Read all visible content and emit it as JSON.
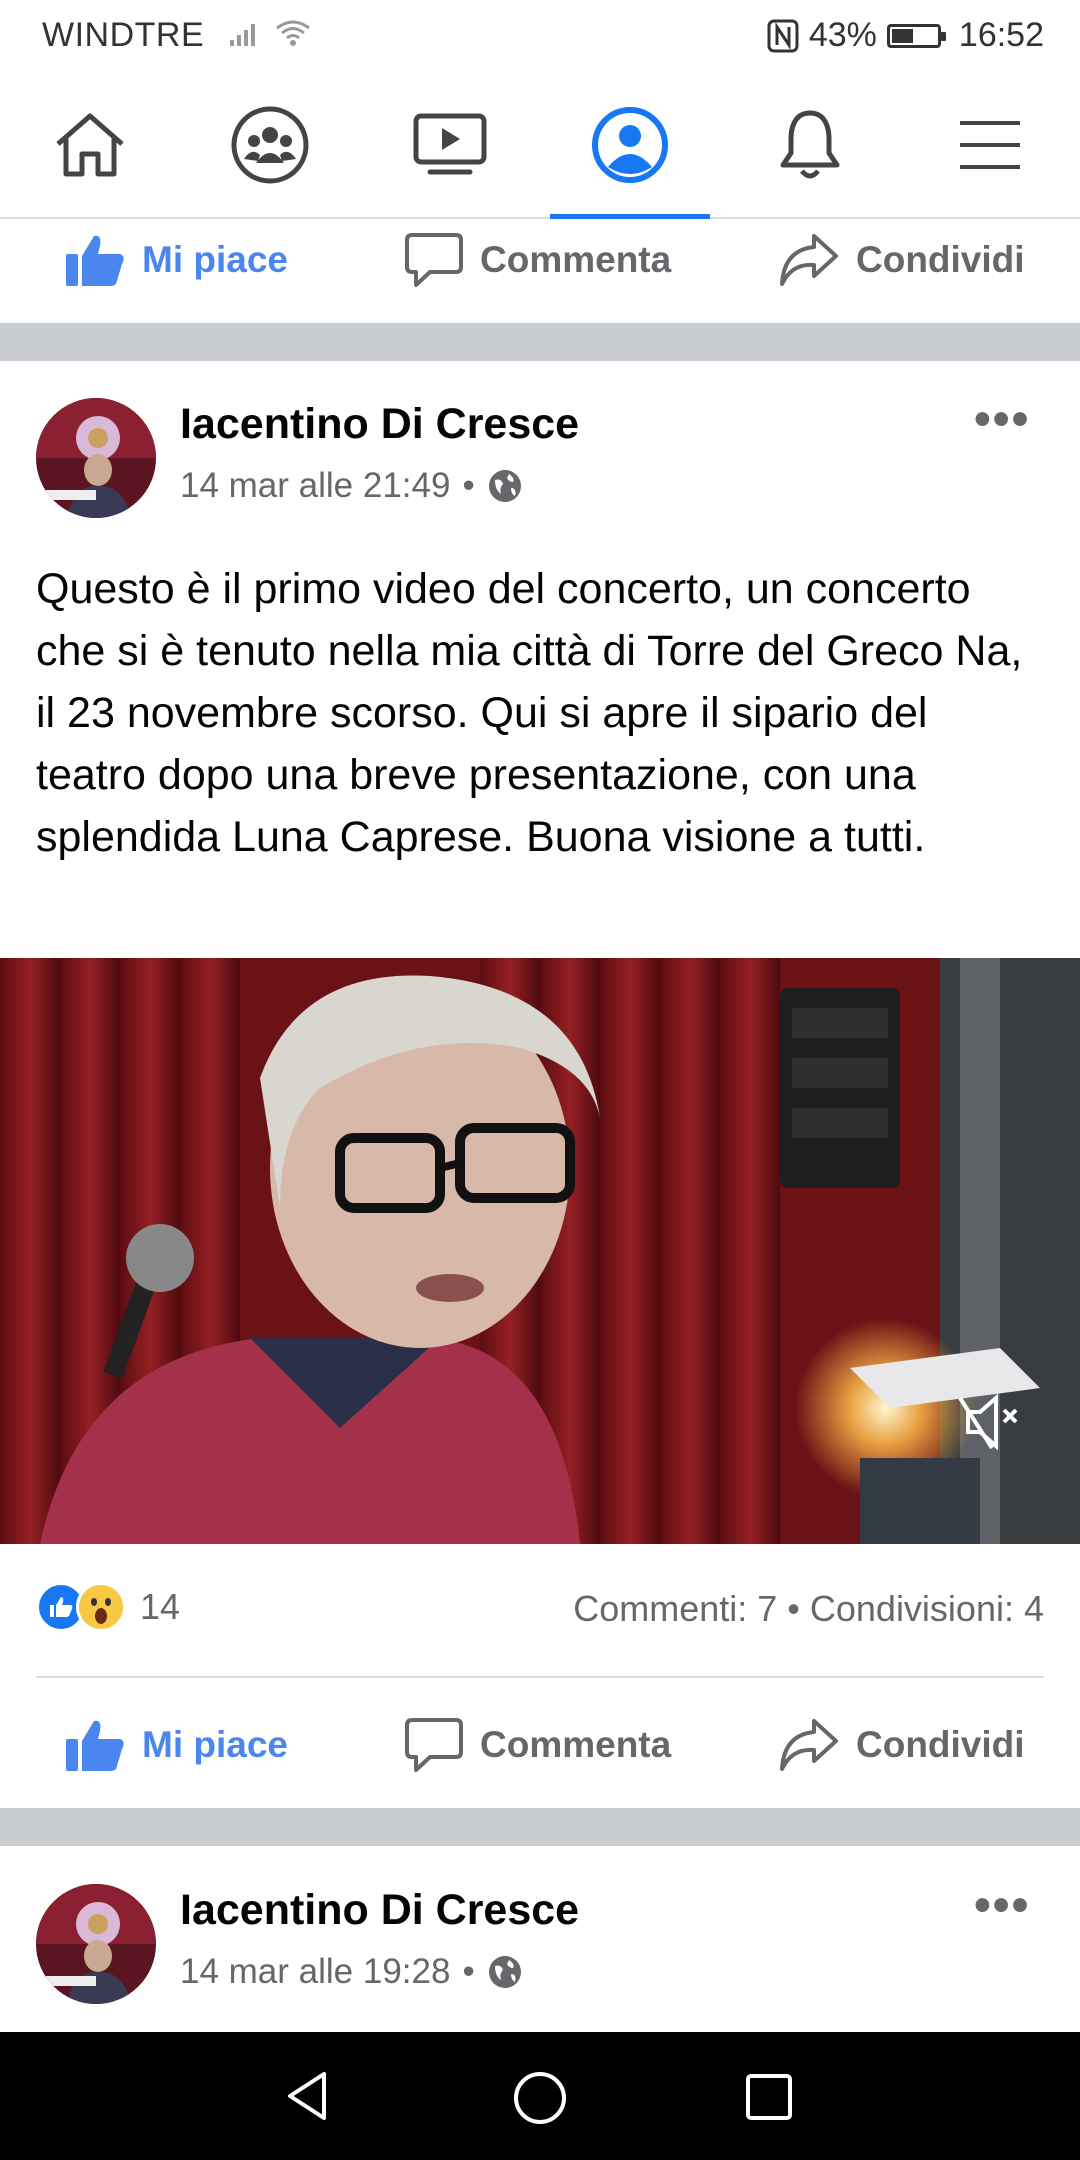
{
  "status_bar": {
    "carrier": "WINDTRE",
    "battery": "43%",
    "time": "16:52",
    "battery_level": 0.43
  },
  "top_nav": {
    "items": [
      {
        "name": "home"
      },
      {
        "name": "groups"
      },
      {
        "name": "watch"
      },
      {
        "name": "profile",
        "active": true
      },
      {
        "name": "notifications"
      },
      {
        "name": "menu"
      }
    ],
    "accent": "#1877f2"
  },
  "actions": {
    "like": "Mi piace",
    "comment": "Commenta",
    "share": "Condividi"
  },
  "post1": {
    "author": "Iacentino Di Cresce",
    "time": "14 mar alle 21:49",
    "text": "Questo è il primo video del concerto, un concerto che si è tenuto nella mia città di Torre del Greco Na, il 23 novembre scorso. Qui si apre il sipario del teatro dopo una breve presentazione, con una splendida Luna Caprese. Buona visione a tutti.",
    "reaction_count": "14",
    "counts": "Commenti: 7 • Condivisioni: 4"
  },
  "post2": {
    "author": "Iacentino Di Cresce",
    "time": "14 mar alle 19:28"
  },
  "colors": {
    "like_blue": "#4b86ee",
    "separator": "#c9ccd1",
    "muted": "#65676b"
  }
}
